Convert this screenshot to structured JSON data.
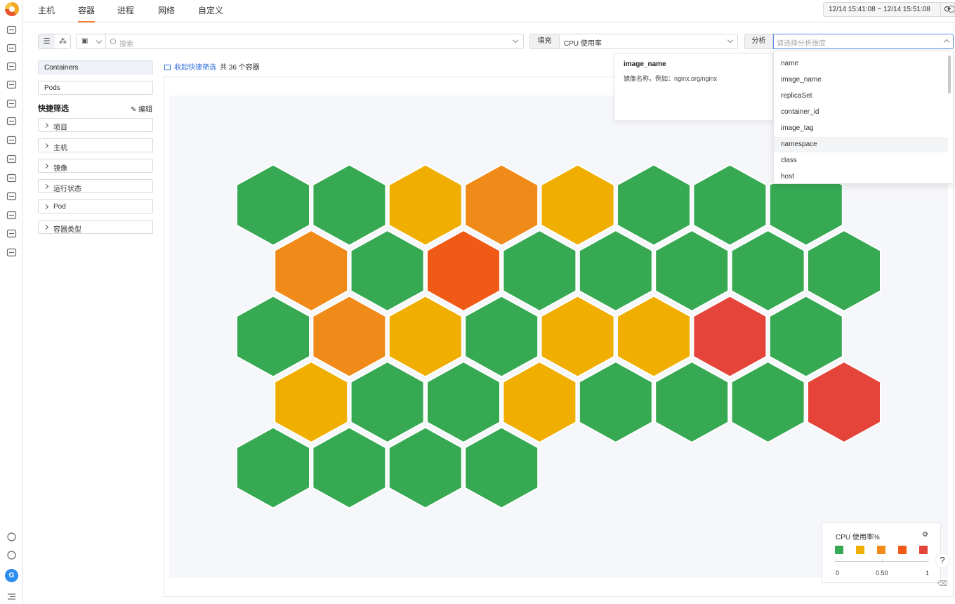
{
  "nav": {
    "tabs": [
      "主机",
      "容器",
      "进程",
      "网络",
      "自定义"
    ],
    "active_tab": "容器",
    "time_range": "12/14 15:41:08 ~ 12/14 15:51:08"
  },
  "sidebar_rail": {
    "icons": [
      "monitor-icon",
      "calendar-icon",
      "infrastructure-icon",
      "metrics-icon",
      "log-search-icon",
      "trace-icon",
      "apps-icon",
      "rum-icon",
      "security-icon",
      "database-icon",
      "synthetic-icon",
      "ci-icon",
      "settings-sliders-icon"
    ],
    "bottom_icons": [
      "send-icon",
      "help-circle-icon"
    ],
    "avatar": "G"
  },
  "toolbar": {
    "search_placeholder": "搜索",
    "fill_label": "填充",
    "fill_value": "CPU 使用率",
    "analyze_label": "分析",
    "analyze_placeholder": "请选择分析维度"
  },
  "filters": {
    "containers_label": "Containers",
    "pods_label": "Pods",
    "quick_filter_title": "快捷筛选",
    "edit_label": "编辑",
    "items": [
      "项目",
      "主机",
      "镜像",
      "运行状态",
      "Pod",
      "容器类型"
    ]
  },
  "main": {
    "collapse_link": "收起快捷筛选",
    "total_text": "共 36 个容器"
  },
  "tooltip": {
    "title": "image_name",
    "desc": "镜像名称，例如：nginx.org/nginx"
  },
  "dropdown": {
    "options": [
      "name",
      "image_name",
      "replicaSet",
      "container_id",
      "image_tag",
      "namespace",
      "class",
      "host"
    ],
    "hovered": "namespace"
  },
  "colors": {
    "green": "#37a953",
    "yellow": "#f0ae00",
    "orange": "#f08a18",
    "deep_orange": "#f05a17",
    "red": "#e5443a"
  },
  "hexmap": {
    "rows": [
      [
        "green",
        "green",
        "yellow",
        "orange",
        "yellow",
        "green",
        "green",
        "green"
      ],
      [
        "orange",
        "green",
        "deep_orange",
        "green",
        "green",
        "green",
        "green",
        "green"
      ],
      [
        "green",
        "orange",
        "yellow",
        "green",
        "yellow",
        "yellow",
        "red",
        "green"
      ],
      [
        "yellow",
        "green",
        "green",
        "yellow",
        "green",
        "green",
        "green",
        "red"
      ],
      [
        "green",
        "green",
        "green",
        "green"
      ]
    ]
  },
  "legend": {
    "title": "CPU 使用率%",
    "swatches": [
      "green",
      "yellow",
      "orange",
      "deep_orange",
      "red"
    ],
    "ticks": [
      "0",
      "0.50",
      "1"
    ]
  }
}
